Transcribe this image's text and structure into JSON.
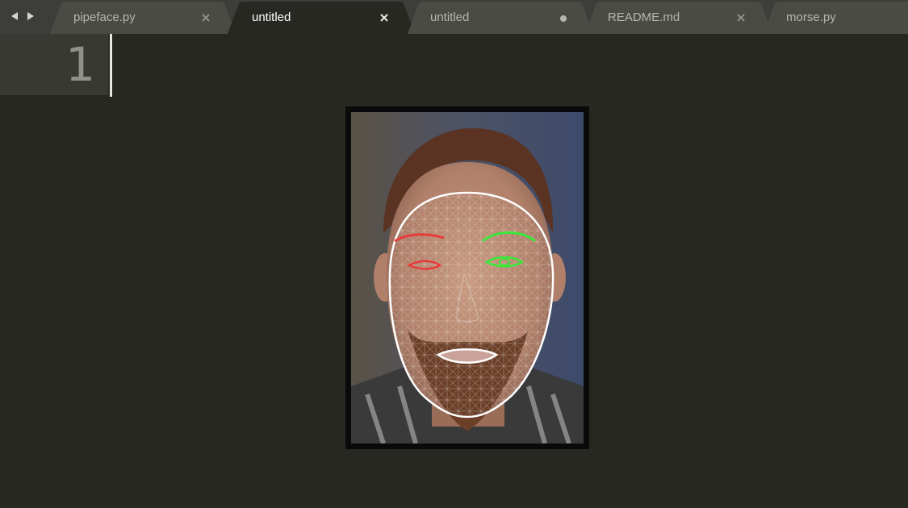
{
  "nav": {
    "back_icon": "triangle-left-icon",
    "forward_icon": "triangle-right-icon"
  },
  "tabs": [
    {
      "label": "pipeface.py",
      "state": "close",
      "active": false
    },
    {
      "label": "untitled",
      "state": "close",
      "active": true
    },
    {
      "label": "untitled",
      "state": "unsaved-dot",
      "active": false
    },
    {
      "label": "README.md",
      "state": "close",
      "active": false
    },
    {
      "label": "morse.py",
      "state": "none",
      "active": false
    }
  ],
  "editor": {
    "line_number": "1"
  },
  "image": {
    "description_icon": "face-mesh-photo"
  },
  "colors": {
    "background": "#272822",
    "tabbar": "#3d3e39",
    "gutter": "#383932",
    "mesh_left": "#e83a3a",
    "mesh_right": "#3ae83a"
  }
}
